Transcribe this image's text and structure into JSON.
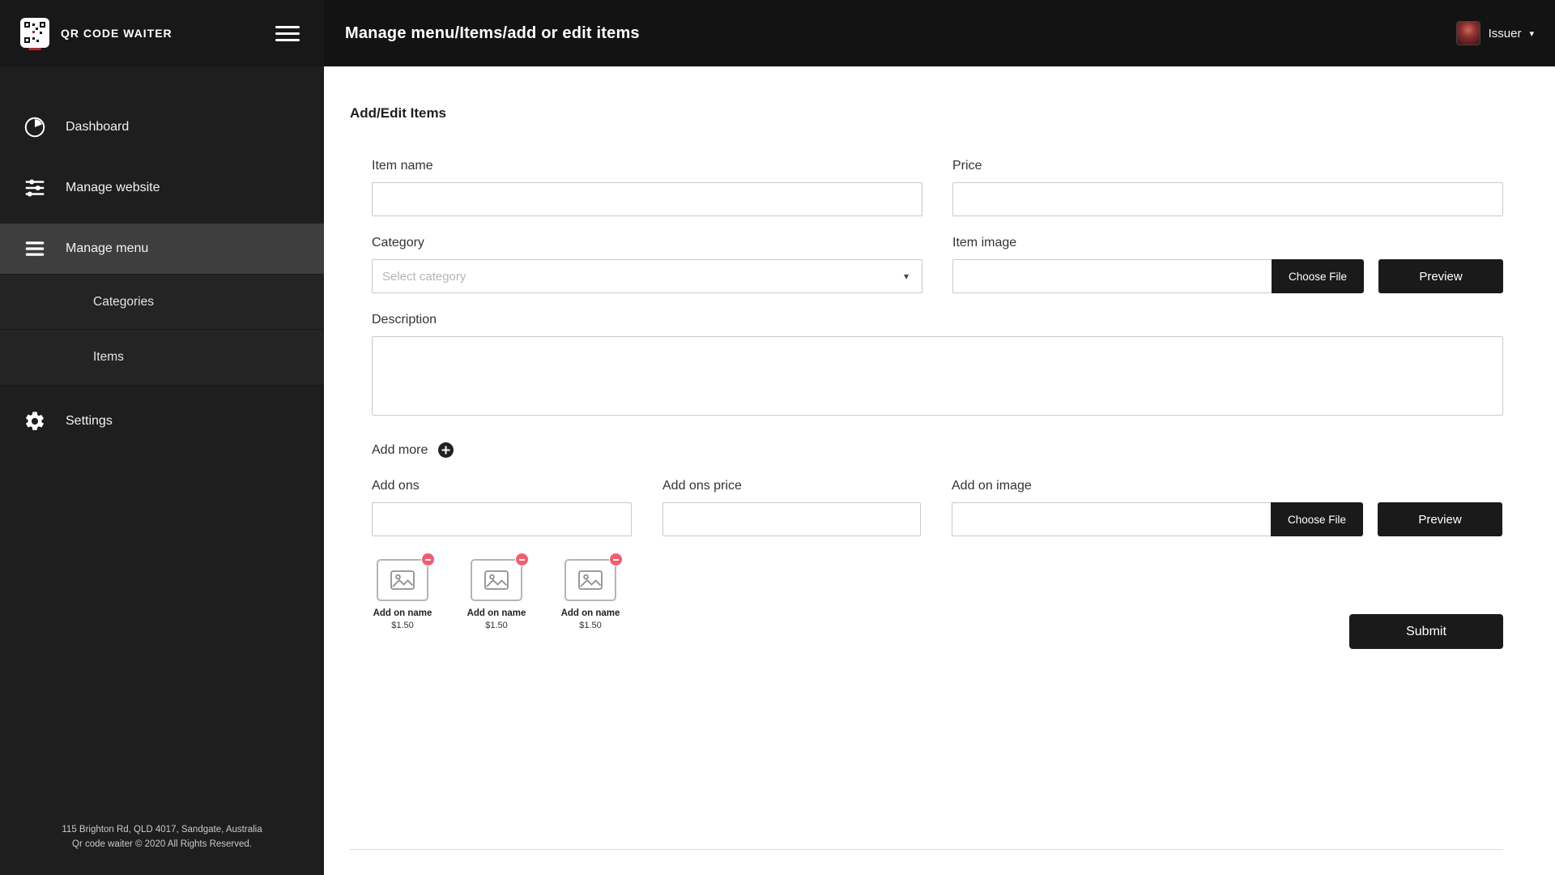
{
  "header": {
    "title": "Manage menu/Items/add or edit items",
    "user_role": "Issuer"
  },
  "sidebar": {
    "brand": "QR CODE WAITER",
    "items": [
      {
        "label": "Dashboard",
        "icon": "dashboard-icon",
        "active": false
      },
      {
        "label": "Manage website",
        "icon": "sliders-icon",
        "active": false
      },
      {
        "label": "Manage menu",
        "icon": "menu-icon",
        "active": true
      },
      {
        "label": "Settings",
        "icon": "gear-icon",
        "active": false
      }
    ],
    "subitems": [
      {
        "label": "Categories"
      },
      {
        "label": "Items"
      }
    ],
    "footer": {
      "line1": "115 Brighton Rd, QLD 4017, Sandgate, Australia",
      "line2": "Qr code waiter © 2020 All Rights Reserved."
    }
  },
  "main": {
    "section_title": "Add/Edit Items",
    "form": {
      "item_name_label": "Item name",
      "price_label": "Price",
      "category_label": "Category",
      "category_placeholder": "Select category",
      "item_image_label": "Item image",
      "choose_file_label": "Choose File",
      "preview_label": "Preview",
      "description_label": "Description",
      "add_more_label": "Add more",
      "add_ons_label": "Add ons",
      "add_ons_price_label": "Add ons price",
      "add_on_image_label": "Add on image",
      "submit_label": "Submit"
    },
    "inputs": {
      "item_name_value": "",
      "price_value": "",
      "item_image_value": "",
      "description_value": "",
      "add_ons_value": "",
      "add_ons_price_value": "",
      "add_on_image_value": ""
    },
    "addons": [
      {
        "name": "Add on name",
        "price": "$1.50"
      },
      {
        "name": "Add on name",
        "price": "$1.50"
      },
      {
        "name": "Add on name",
        "price": "$1.50"
      }
    ]
  },
  "icons": {
    "dropdown_caret": "▾"
  },
  "colors": {
    "sidebar_bg": "#1e1e1e",
    "header_bg": "#131313",
    "active_item_bg": "#3e3e3e",
    "button_bg": "#1a1a1a",
    "badge_red": "#f35d71"
  }
}
